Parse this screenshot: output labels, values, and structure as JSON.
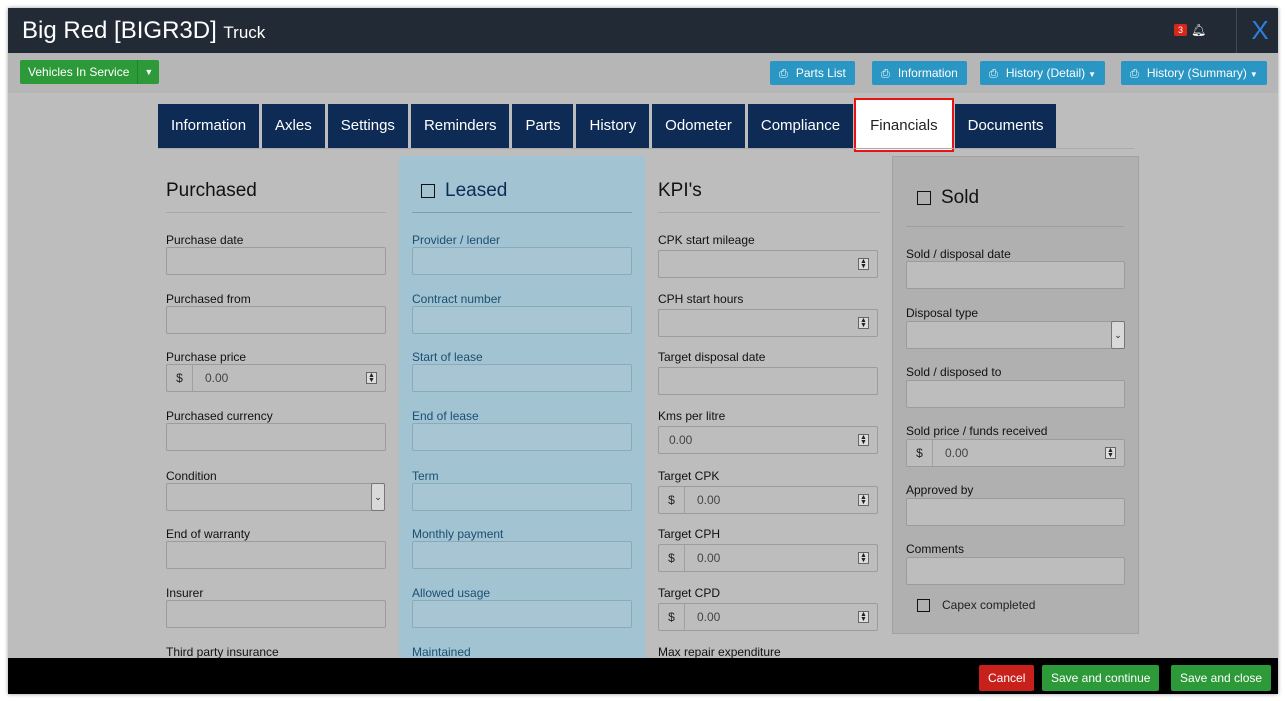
{
  "window": {
    "title_main": "Big Red [BIGR3D]",
    "title_sub": "Truck",
    "notifications_count": "3",
    "close_label": "X"
  },
  "toolbar": {
    "status_button": "Vehicles In Service",
    "print_buttons": {
      "parts_list": "Parts List",
      "information": "Information",
      "history_detail": "History (Detail)",
      "history_summary": "History (Summary)"
    }
  },
  "tabs": [
    "Information",
    "Axles",
    "Settings",
    "Reminders",
    "Parts",
    "History",
    "Odometer",
    "Compliance",
    "Financials",
    "Documents"
  ],
  "active_tab": "Financials",
  "purchased": {
    "heading": "Purchased",
    "purchase_date_label": "Purchase date",
    "purchased_from_label": "Purchased from",
    "purchase_price_label": "Purchase price",
    "purchase_price_symbol": "$",
    "purchase_price_placeholder": "0.00",
    "currency_label": "Purchased currency",
    "condition_label": "Condition",
    "warranty_label": "End of warranty",
    "insurer_label": "Insurer",
    "third_party_label": "Third party insurance"
  },
  "leased": {
    "heading": "Leased",
    "provider_label": "Provider / lender",
    "contract_label": "Contract number",
    "start_label": "Start of lease",
    "end_label": "End of lease",
    "term_label": "Term",
    "monthly_label": "Monthly payment",
    "usage_label": "Allowed usage",
    "maintained_label": "Maintained"
  },
  "kpis": {
    "heading": "KPI's",
    "cpk_start_label": "CPK start mileage",
    "cph_start_label": "CPH start hours",
    "target_disposal_label": "Target disposal date",
    "kms_per_litre_label": "Kms per litre",
    "kms_per_litre_placeholder": "0.00",
    "target_cpk_label": "Target CPK",
    "target_cpk_symbol": "$",
    "target_cpk_placeholder": "0.00",
    "target_cph_label": "Target CPH",
    "target_cph_symbol": "$",
    "target_cph_placeholder": "0.00",
    "target_cpd_label": "Target CPD",
    "target_cpd_symbol": "$",
    "target_cpd_placeholder": "0.00",
    "max_repair_label": "Max repair expenditure"
  },
  "sold": {
    "heading": "Sold",
    "disposal_date_label": "Sold / disposal date",
    "disposal_type_label": "Disposal type",
    "disposed_to_label": "Sold / disposed to",
    "price_label": "Sold price / funds received",
    "price_symbol": "$",
    "price_placeholder": "0.00",
    "approved_label": "Approved by",
    "comments_label": "Comments",
    "capex_label": "Capex completed"
  },
  "footer": {
    "cancel": "Cancel",
    "save_continue": "Save and continue",
    "save_close": "Save and close"
  },
  "colors": {
    "title_bar": "#222a35",
    "tab_bg": "#0d2b55",
    "active_tab_outline": "#e11111",
    "print_button": "#2a96c4",
    "success": "#2d9a39",
    "danger": "#c8201b",
    "leased_panel": "#a2c3d2"
  },
  "icons": {
    "print": "printer-icon",
    "notification": "bell-icon",
    "spinner": "spinner-icon",
    "dropdown": "chevron-down-icon"
  }
}
